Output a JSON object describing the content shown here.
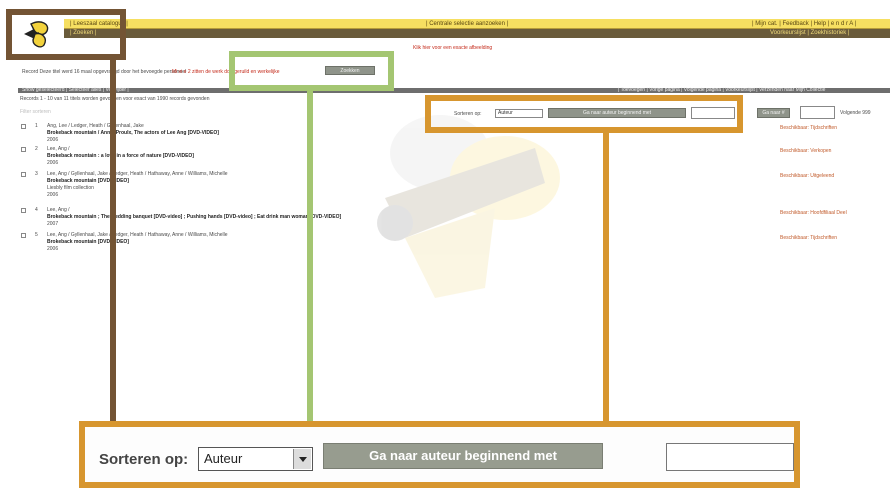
{
  "app": {
    "nav_left": "| Leeszaal catalogus |",
    "nav_center": "| Centrale selectie aanzoeken |",
    "nav_right": "| Mijn cat. | Feedback | Help | e n d r A |",
    "subnav_left": "| Zoeken |",
    "subnav_right": "Voorkeurslijst | Zoekhistoriek |"
  },
  "notice": "Klik hier voor een exacte afbeelding",
  "result_line": "Record Deze titel werd 16 maal opgevraagd door het bevoegde personeel",
  "result_line_red": "Mi vi e 2 zitten de werk doorgeruild en werkelijke",
  "search_button": "Zoekken",
  "section_bar_left": "Show geselecteerd | Selecteer alles | Verwijder |",
  "section_bar_right": "| Toevoegen | Vorige pagina | Volgende pagina | Voorkeurslijst | Verzenden naar Mijn Collectie",
  "records_summary": "Records 1 - 10 van 11 titels worden gevonden voor exact van 1990 records gevonden",
  "filter_caption": "Filter sorteren",
  "sort": {
    "label": "Sorteren op:",
    "selected": "Auteur",
    "go_button": "Ga naar auteur beginnend met",
    "input_value": ""
  },
  "page_jump": {
    "button": "Ga naar #",
    "label": "Volgende 999"
  },
  "results": [
    {
      "num": "1",
      "line1": "Ang, Lee / Ledger, Heath / Gyllenhaal, Jake",
      "line2": "Brokeback mountain / Annie Proulx, The actors of Lee Ang [DVD-VIDEO]",
      "line3": "2006",
      "line4": "",
      "link": "Beschikbaar: Tijdschriften"
    },
    {
      "num": "2",
      "line1": "Lee, Ang /",
      "line2": "Brokeback mountain : a love in a force of nature [DVD-VIDEO]",
      "line3": "2006",
      "line4": "",
      "link": "Beschikbaar: Verkopen"
    },
    {
      "num": "3",
      "line1": "Lee, Ang / Gyllenhaal, Jake / Ledger, Heath / Hathaway, Anne / Williams, Michelle",
      "line2": "Brokeback mountain [DVD-VIDEO]",
      "line3": "Liesbly film collection",
      "line4": "2006",
      "link": "Beschikbaar: Uitgeleend"
    },
    {
      "num": "4",
      "line1": "Lee, Ang /",
      "line2": "Brokeback mountain ; The wedding banquet [DVD-video] ; Pushing hands [DVD-video] ; Eat drink man woman [DVD-VIDEO]",
      "line3": "2007",
      "line4": "",
      "link": "Beschikbaar: Hoofdfiliaal Deel"
    },
    {
      "num": "5",
      "line1": "Lee, Ang / Gyllenhaal, Jake / Ledger, Heath / Hathaway, Anne / Williams, Michelle",
      "line2": "Brokeback mountain [DVD-VIDEO]",
      "line3": "2006",
      "line4": "",
      "link": "Beschikbaar: Tijdschriften"
    }
  ]
}
